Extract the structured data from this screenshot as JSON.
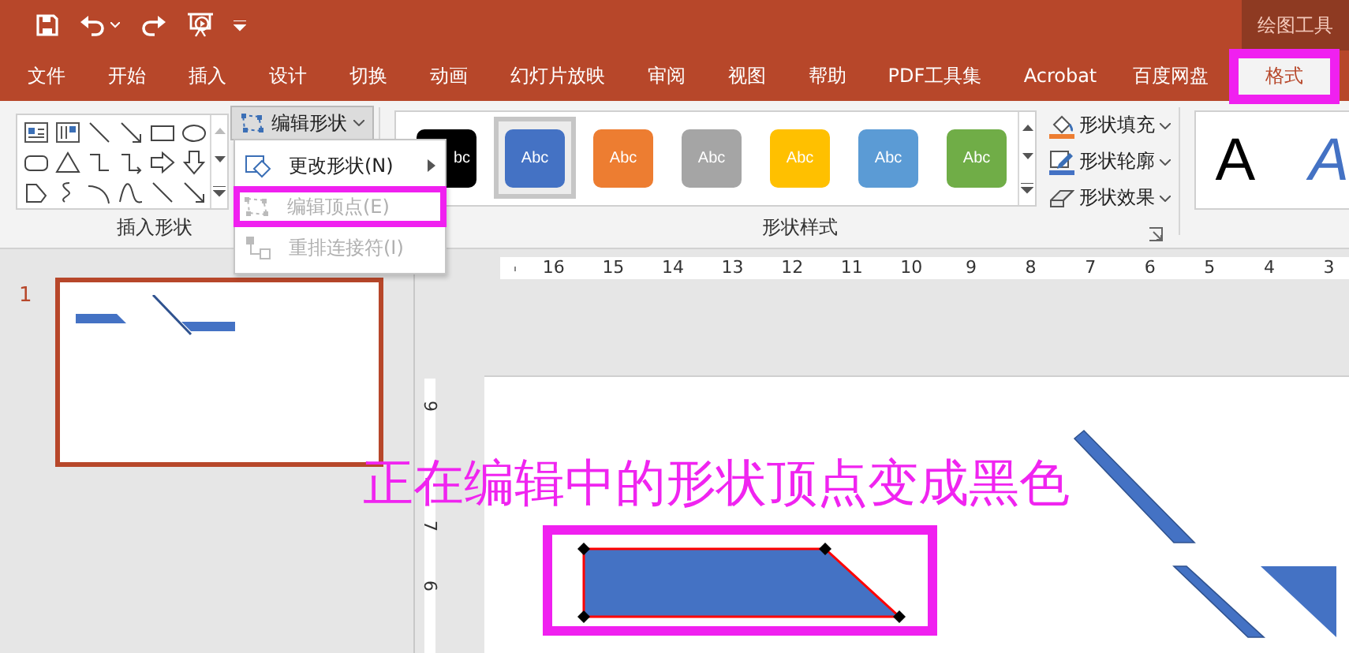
{
  "title_bar": {
    "context_label": "绘图工具"
  },
  "tabs": [
    {
      "label": "文件",
      "selected": false,
      "highlighted": false
    },
    {
      "label": "开始",
      "selected": false,
      "highlighted": false
    },
    {
      "label": "插入",
      "selected": false,
      "highlighted": false
    },
    {
      "label": "设计",
      "selected": false,
      "highlighted": false
    },
    {
      "label": "切换",
      "selected": false,
      "highlighted": false
    },
    {
      "label": "动画",
      "selected": false,
      "highlighted": false
    },
    {
      "label": "幻灯片放映",
      "selected": false,
      "highlighted": false
    },
    {
      "label": "审阅",
      "selected": false,
      "highlighted": false
    },
    {
      "label": "视图",
      "selected": false,
      "highlighted": false
    },
    {
      "label": "帮助",
      "selected": false,
      "highlighted": false
    },
    {
      "label": "PDF工具集",
      "selected": false,
      "highlighted": false
    },
    {
      "label": "Acrobat",
      "selected": false,
      "highlighted": false
    },
    {
      "label": "百度网盘",
      "selected": false,
      "highlighted": false
    },
    {
      "label": "格式",
      "selected": true,
      "highlighted": true
    }
  ],
  "ribbon": {
    "insert_shapes": {
      "label": "插入形状"
    },
    "edit_shape_button": {
      "label": "编辑形状"
    },
    "shape_styles": {
      "label": "形状样式",
      "swatches": [
        {
          "text": "bc",
          "color": "#000000",
          "selected": false
        },
        {
          "text": "Abc",
          "color": "#4472c4",
          "selected": true
        },
        {
          "text": "Abc",
          "color": "#ed7d31",
          "selected": false
        },
        {
          "text": "Abc",
          "color": "#a5a5a5",
          "selected": false
        },
        {
          "text": "Abc",
          "color": "#ffc000",
          "selected": false
        },
        {
          "text": "Abc",
          "color": "#5b9bd5",
          "selected": false
        },
        {
          "text": "Abc",
          "color": "#70ad47",
          "selected": false
        }
      ]
    },
    "shape_commands": [
      {
        "kind": "fill",
        "label": "形状填充"
      },
      {
        "kind": "outline",
        "label": "形状轮廓"
      },
      {
        "kind": "effects",
        "label": "形状效果"
      }
    ],
    "wordart": [
      {
        "text": "A",
        "color": "#000000"
      },
      {
        "text": "A",
        "color": "#4472c4"
      }
    ]
  },
  "edit_shape_menu": [
    {
      "label": "更改形状(N)",
      "disabled": false,
      "submenu": true,
      "highlighted": false
    },
    {
      "label": "编辑顶点(E)",
      "disabled": true,
      "submenu": false,
      "highlighted": true
    },
    {
      "label": "重排连接符(I)",
      "disabled": true,
      "submenu": false,
      "highlighted": false
    }
  ],
  "slide_panel": {
    "slides": [
      {
        "number": "1",
        "selected": true
      }
    ]
  },
  "horizontal_ruler": [
    "16",
    "15",
    "14",
    "13",
    "12",
    "11",
    "10",
    "9",
    "8",
    "7",
    "6",
    "5",
    "4",
    "3"
  ],
  "vertical_ruler": [
    "9",
    "7",
    "6"
  ],
  "slide": {
    "shape_highlighted": true
  },
  "annotation": "正在编辑中的形状顶点变成黑色"
}
